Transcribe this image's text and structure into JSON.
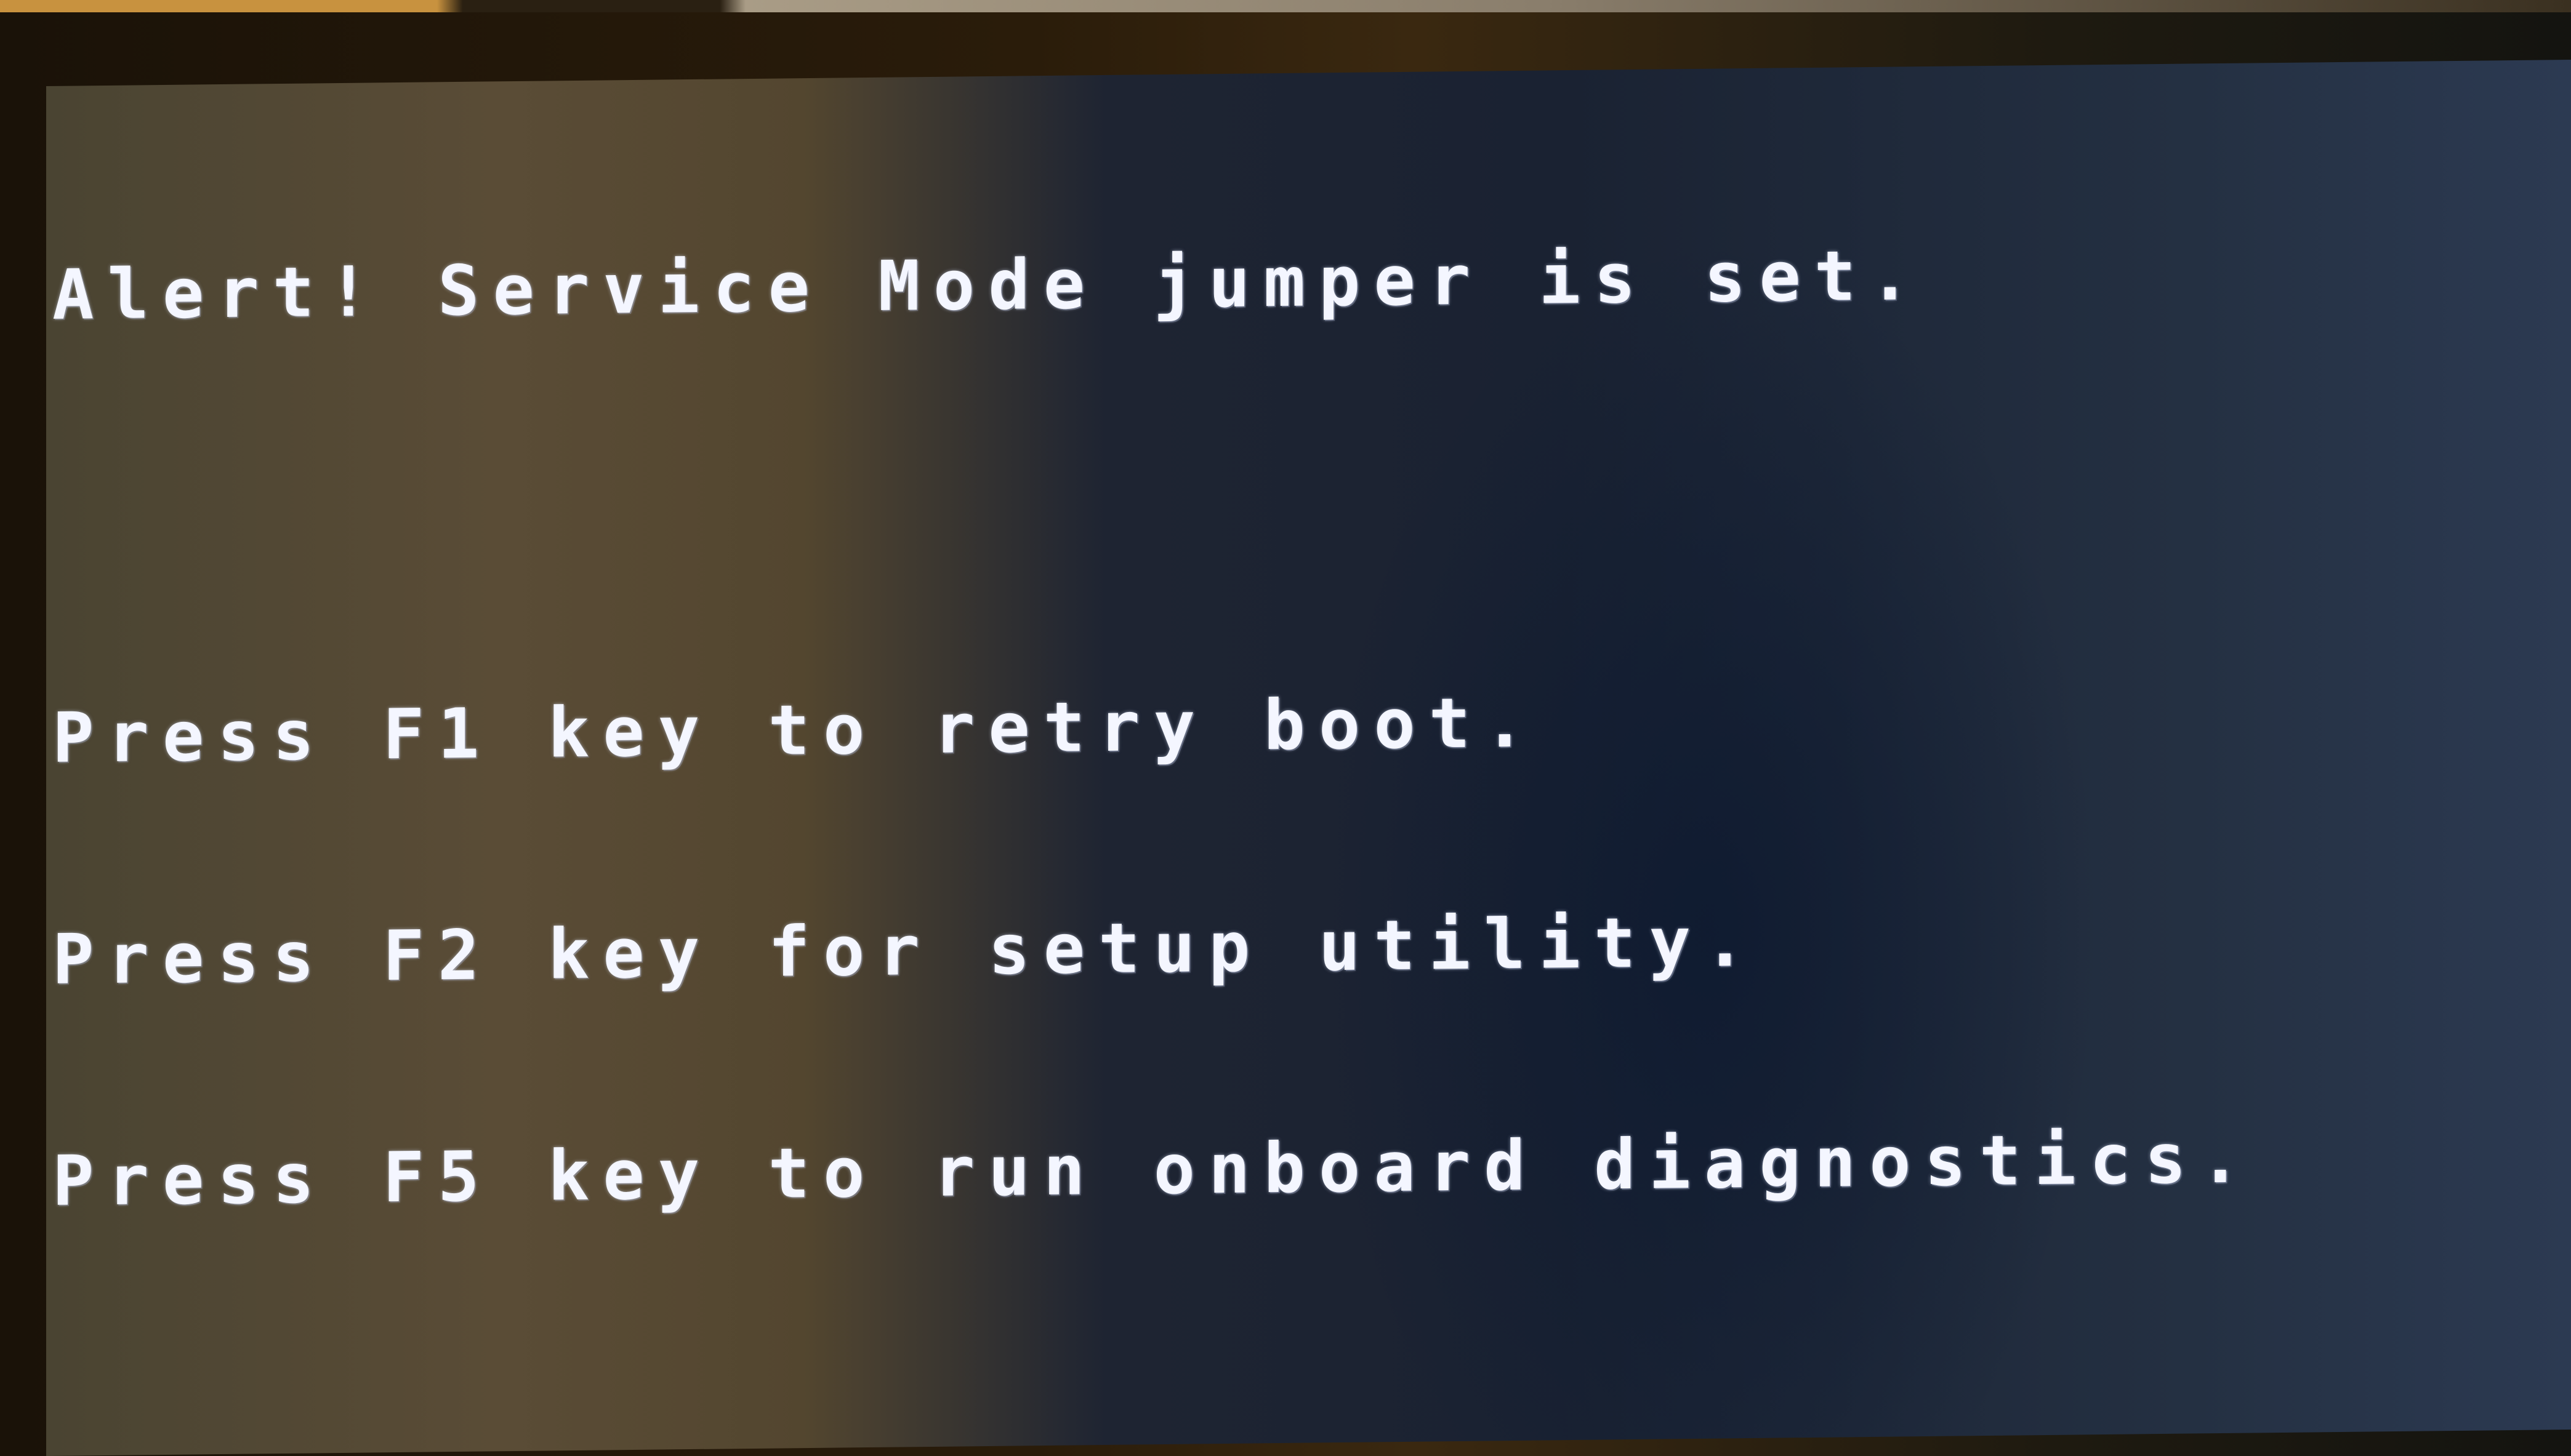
{
  "bios_screen": {
    "alert_message": "Alert! Service Mode jumper is set.",
    "options": [
      {
        "key": "F1",
        "text": "Press F1 key to retry boot."
      },
      {
        "key": "F2",
        "text": "Press F2 key for setup utility."
      },
      {
        "key": "F5",
        "text": "Press F5 key to run onboard diagnostics."
      }
    ]
  },
  "colors": {
    "text": "#f4f6ff",
    "screen_left": "#5a4c36",
    "screen_right": "#1a2232"
  }
}
